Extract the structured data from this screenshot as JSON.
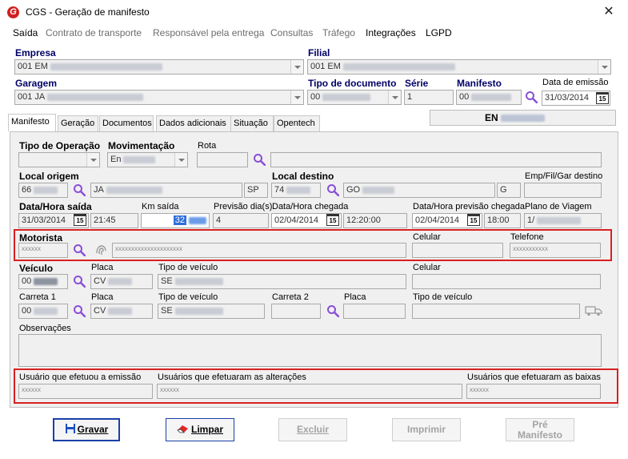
{
  "window": {
    "title": "CGS - Geração de manifesto",
    "close_symbol": "✕"
  },
  "menu": {
    "items": [
      "Saída",
      "Contrato de transporte",
      "Responsável pela entrega",
      "Consultas",
      "Tráfego",
      "Integrações",
      "LGPD"
    ]
  },
  "header": {
    "empresa_label": "Empresa",
    "empresa_value": "001 EM",
    "filial_label": "Filial",
    "filial_value": "001 EM",
    "garagem_label": "Garagem",
    "garagem_value": "001 JA",
    "tipo_documento_label": "Tipo de documento",
    "tipo_documento_value": "00",
    "serie_label": "Série",
    "serie_value": "1",
    "manifesto_label": "Manifesto",
    "manifesto_value": "00",
    "data_emissao_label": "Data de emissão",
    "data_emissao_value": "31/03/2014",
    "status_value": "EN"
  },
  "tabs": [
    "Manifesto",
    "Geração",
    "Documentos",
    "Dados adicionais",
    "Situação",
    "Opentech"
  ],
  "form": {
    "tipo_operacao_label": "Tipo de Operação",
    "movimentacao_label": "Movimentação",
    "movimentacao_value": "En",
    "rota_label": "Rota",
    "local_origem_label": "Local origem",
    "local_origem_code": "66",
    "local_origem_name": "JA",
    "local_origem_uf": "SP",
    "local_destino_label": "Local destino",
    "local_destino_code": "74",
    "local_destino_name": "GO",
    "local_destino_uf": "G",
    "emp_fil_gar_label": "Emp/Fil/Gar destino",
    "data_hora_saida_label": "Data/Hora saída",
    "data_saida_value": "31/03/2014",
    "hora_saida_value": "21:45",
    "km_saida_label": "Km saída",
    "km_saida_value": "32",
    "previsao_dias_label": "Previsão dia(s)",
    "previsao_dias_value": "4",
    "data_hora_chegada_label": "Data/Hora chegada",
    "data_chegada_value": "02/04/2014",
    "hora_chegada_value": "12:20:00",
    "previsao_chegada_label": "Data/Hora previsão chegada",
    "data_prev_chegada_value": "02/04/2014",
    "hora_prev_chegada_value": "18:00",
    "plano_viagem_label": "Plano de Viagem",
    "plano_viagem_value": "1/",
    "motorista_label": "Motorista",
    "motorista_code": "xxxxxx",
    "motorista_name": "xxxxxxxxxxxxxxxxxxxxx",
    "motorista_celular_label": "Celular",
    "motorista_telefone_label": "Telefone",
    "motorista_telefone_value": "xxxxxxxxxxx",
    "veiculo_label": "Veículo",
    "veiculo_code": "00",
    "veiculo_placa_label": "Placa",
    "veiculo_placa_value": "CV",
    "veiculo_tipo_label": "Tipo de veículo",
    "veiculo_tipo_value": "SE",
    "veiculo_celular_label": "Celular",
    "carreta1_label": "Carreta 1",
    "carreta1_code": "00",
    "carreta1_placa_label": "Placa",
    "carreta1_placa_value": "CV",
    "carreta1_tipo_label": "Tipo de veículo",
    "carreta1_tipo_value": "SE",
    "carreta2_label": "Carreta 2",
    "carreta2_placa_label": "Placa",
    "carreta2_tipo_label": "Tipo de veículo",
    "observacoes_label": "Observações",
    "usuario_emissao_label": "Usuário que efetuou a emissão",
    "usuario_emissao_value": "xxxxxx",
    "usuarios_alteracoes_label": "Usuários que efetuaram as alterações",
    "usuarios_alteracoes_value": "xxxxxx",
    "usuarios_baixas_label": "Usuários que efetuaram as baixas",
    "usuarios_baixas_value": "xxxxxx"
  },
  "buttons": {
    "gravar": "Gravar",
    "limpar": "Limpar",
    "excluir": "Excluir",
    "imprimir": "Imprimir",
    "pre_manifesto_line1": "Pré",
    "pre_manifesto_line2": "Manifesto"
  },
  "colors": {
    "highlight_red": "#d82020",
    "search_icon": "#8a4fd6",
    "primary_border": "#1a3fa8"
  }
}
